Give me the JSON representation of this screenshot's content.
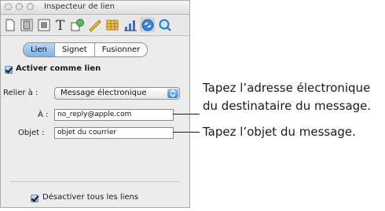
{
  "window": {
    "title": "Inspecteur de lien"
  },
  "toolbar": {
    "icons": [
      "document-icon",
      "layout-icon",
      "wrap-icon",
      "text-icon",
      "graphic-icon",
      "metrics-icon",
      "table-icon",
      "chart-icon",
      "link-icon",
      "quicktime-icon"
    ],
    "active": "link-icon"
  },
  "tabs": [
    {
      "label": "Lien",
      "selected": true
    },
    {
      "label": "Signet",
      "selected": false
    },
    {
      "label": "Fusionner",
      "selected": false
    }
  ],
  "enable_link": {
    "label": "Activer comme lien",
    "checked": true
  },
  "relier": {
    "label": "Relier à :",
    "value": "Message électronique"
  },
  "to": {
    "label": "À :",
    "value": "no_reply@apple.com"
  },
  "subject": {
    "label": "Objet :",
    "value": "objet du courrier"
  },
  "disable_all": {
    "label": "Désactiver tous les liens",
    "checked": true
  },
  "annotations": {
    "address_line1": "Tapez l’adresse électronique",
    "address_line2": "du destinataire du message.",
    "subject_text": "Tapez l’objet du message."
  },
  "colors": {
    "accent": "#3f85d8",
    "panel": "#ececec"
  }
}
